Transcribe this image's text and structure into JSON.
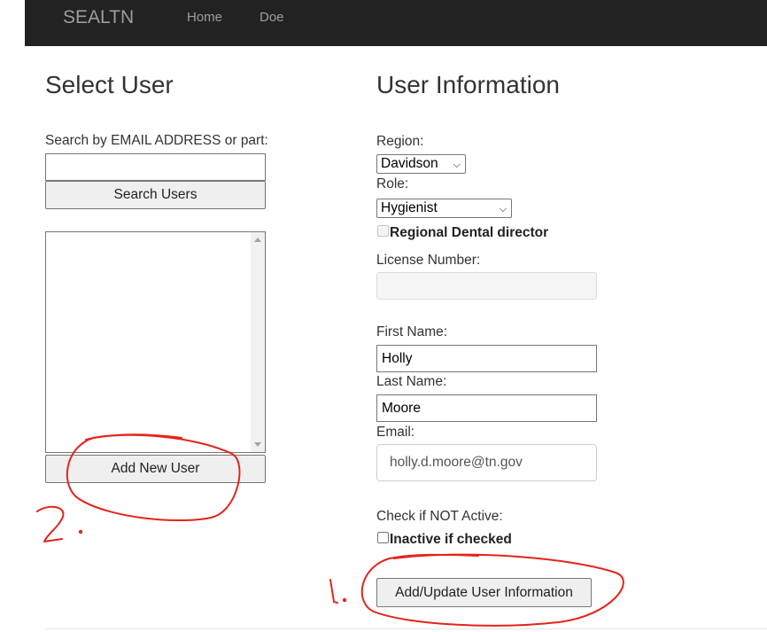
{
  "navbar": {
    "brand": "SEALTN",
    "links": [
      {
        "label": "Home"
      },
      {
        "label": "Doe"
      }
    ]
  },
  "select_user": {
    "title": "Select User",
    "search_label": "Search by EMAIL ADDRESS or part:",
    "search_value": "",
    "search_button": "Search Users",
    "user_list": [],
    "add_button": "Add New User"
  },
  "user_info": {
    "title": "User Information",
    "region_label": "Region:",
    "region_value": "Davidson",
    "role_label": "Role:",
    "role_value": "Hygienist",
    "regional_director_label": "Regional Dental director",
    "regional_director_checked": false,
    "license_label": "License Number:",
    "license_value": "",
    "first_name_label": "First Name:",
    "first_name_value": "Holly",
    "last_name_label": "Last Name:",
    "last_name_value": "Moore",
    "email_label": "Email:",
    "email_value": "holly.d.moore@tn.gov",
    "not_active_label": "Check if NOT Active:",
    "inactive_label": "Inactive if checked",
    "inactive_checked": false,
    "submit_button": "Add/Update User Information"
  },
  "annotations": {
    "color": "#e3241b",
    "mark_1": "1.",
    "mark_2": "2."
  }
}
